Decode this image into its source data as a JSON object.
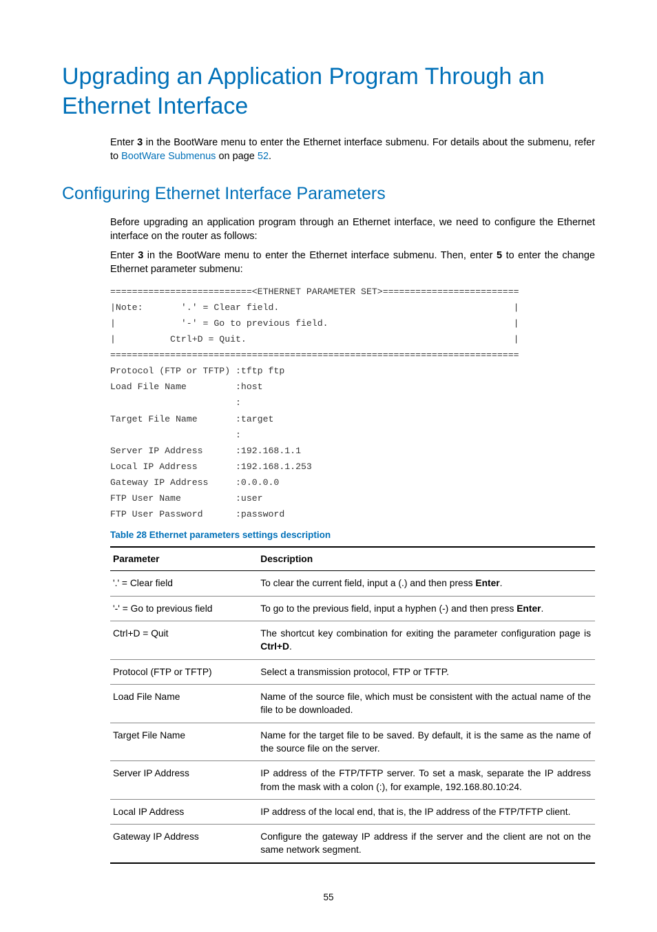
{
  "h1": "Upgrading an Application Program Through an Ethernet Interface",
  "intro": {
    "pre": "Enter ",
    "bold1": "3",
    "mid": " in the BootWare menu to enter the Ethernet interface submenu. For details about the submenu, refer to ",
    "link1": "BootWare Submenus",
    "mid2": " on page ",
    "link2": "52",
    "end": "."
  },
  "h2": "Configuring Ethernet Interface Parameters",
  "p2": "Before upgrading an application program through an Ethernet interface, we need to configure the Ethernet interface on the router as follows:",
  "p3": {
    "pre": "Enter ",
    "b1": "3",
    "mid": " in the BootWare menu to enter the Ethernet interface submenu. Then, enter ",
    "b2": "5",
    "end": " to enter the change Ethernet parameter submenu:"
  },
  "code": "==========================<ETHERNET PARAMETER SET>=========================\n|Note:       '.' = Clear field.                                           |\n|            '-' = Go to previous field.                                  |\n|          Ctrl+D = Quit.                                                 |\n===========================================================================\nProtocol (FTP or TFTP) :tftp ftp\nLoad File Name         :host\n                       :\nTarget File Name       :target\n                       :\nServer IP Address      :192.168.1.1\nLocal IP Address       :192.168.1.253\nGateway IP Address     :0.0.0.0\nFTP User Name          :user\nFTP User Password      :password",
  "tableCaption": "Table 28 Ethernet parameters settings description",
  "th1": "Parameter",
  "th2": "Description",
  "rows": [
    {
      "p": "'.' = Clear field",
      "d": "To clear the current field, input a (.) and then press <b>Enter</b>."
    },
    {
      "p": "'-' = Go to previous field",
      "d": "To go to the previous field, input a hyphen (-) and then press <b>Enter</b>."
    },
    {
      "p": "Ctrl+D = Quit",
      "d": "The shortcut key combination for exiting the parameter configuration page is <b>Ctrl+D</b>."
    },
    {
      "p": "Protocol (FTP or TFTP)",
      "d": "Select a transmission protocol, FTP or TFTP."
    },
    {
      "p": "Load File Name",
      "d": "Name of the source file, which must be consistent with the actual name of the file to be downloaded."
    },
    {
      "p": "Target File Name",
      "d": "Name for the target file to be saved. By default, it is the same as the name of the source file on the server."
    },
    {
      "p": "Server IP Address",
      "d": "IP address of the FTP/TFTP server. To set a mask, separate the IP address from the mask with a colon (:), for example, 192.168.80.10:24."
    },
    {
      "p": "Local IP Address",
      "d": "IP address of the local end, that is, the IP address of the FTP/TFTP client."
    },
    {
      "p": "Gateway IP Address",
      "d": "Configure the gateway IP address if the server and the client are not on the same network segment."
    }
  ],
  "pageNumber": "55"
}
